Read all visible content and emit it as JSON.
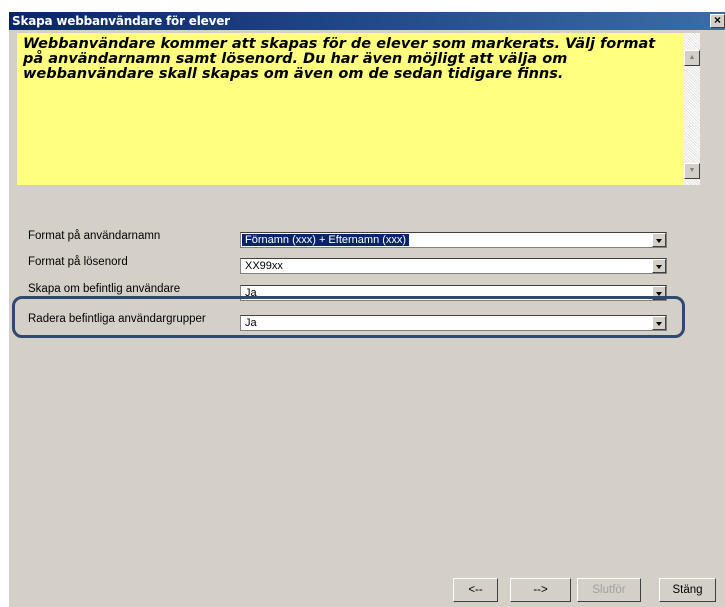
{
  "colors": {
    "titlebar_start": "#0a246a",
    "titlebar_end": "#3a6ea5",
    "info_background": "#ffff80",
    "highlight_border": "#2f4a6e"
  },
  "window": {
    "title": "Skapa webbanvändare för elever",
    "close_icon": "close-icon"
  },
  "info": {
    "text": "Webbanvändare kommer att skapas för de elever som markerats. Välj format på användarnamn samt lösenord. Du har även möjligt att välja om webbanvändare skall skapas om även om de sedan tidigare finns."
  },
  "form": {
    "rows": [
      {
        "label": "Format på användarnamn",
        "value": "Förnamn (xxx) + Efternamn (xxx)"
      },
      {
        "label": "Format på lösenord",
        "value": "XX99xx"
      },
      {
        "label": "Skapa om befintlig användare",
        "value": "Ja"
      },
      {
        "label": "Radera befintliga användargrupper",
        "value": "Ja"
      }
    ]
  },
  "buttons": {
    "back": "<--",
    "next": "-->",
    "finish": "Slutför",
    "close": "Stäng"
  }
}
